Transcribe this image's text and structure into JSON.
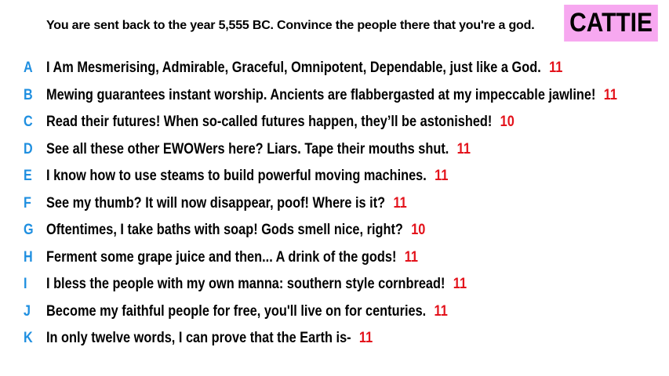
{
  "prompt": "You are sent back to the year 5,555 BC. Convince the people there that you're a god.",
  "badge": {
    "label": "CATTIE",
    "background": "#f7a8f0"
  },
  "colors": {
    "letter": "#1f8fe0",
    "score": "#e3121b"
  },
  "entries": [
    {
      "letter": "A",
      "text": "I Am Mesmerising, Admirable, Graceful, Omnipotent, Dependable, just like a God.",
      "score": "11"
    },
    {
      "letter": "B",
      "text": "Mewing guarantees instant worship. Ancients are flabbergasted at my impeccable jawline!",
      "score": "11"
    },
    {
      "letter": "C",
      "text": "Read their futures! When so-called futures happen, they’ll be astonished!",
      "score": "10"
    },
    {
      "letter": "D",
      "text": "See all these other EWOWers here? Liars. Tape their mouths shut.",
      "score": "11"
    },
    {
      "letter": "E",
      "text": "I know how to use steams to build powerful moving machines.",
      "score": "11"
    },
    {
      "letter": "F",
      "text": "See my thumb? It will now disappear, poof! Where is it?",
      "score": "11"
    },
    {
      "letter": "G",
      "text": "Oftentimes, I take baths with soap! Gods smell nice, right?",
      "score": "10"
    },
    {
      "letter": "H",
      "text": "Ferment some grape juice and then... A drink of the gods!",
      "score": "11"
    },
    {
      "letter": "I",
      "text": "I bless the people with my own manna: southern style cornbread!",
      "score": "11"
    },
    {
      "letter": "J",
      "text": "Become my faithful people for free, you'll live on for centuries.",
      "score": "11"
    },
    {
      "letter": "K",
      "text": "In only twelve words, I can prove that the Earth is-",
      "score": "11"
    }
  ]
}
